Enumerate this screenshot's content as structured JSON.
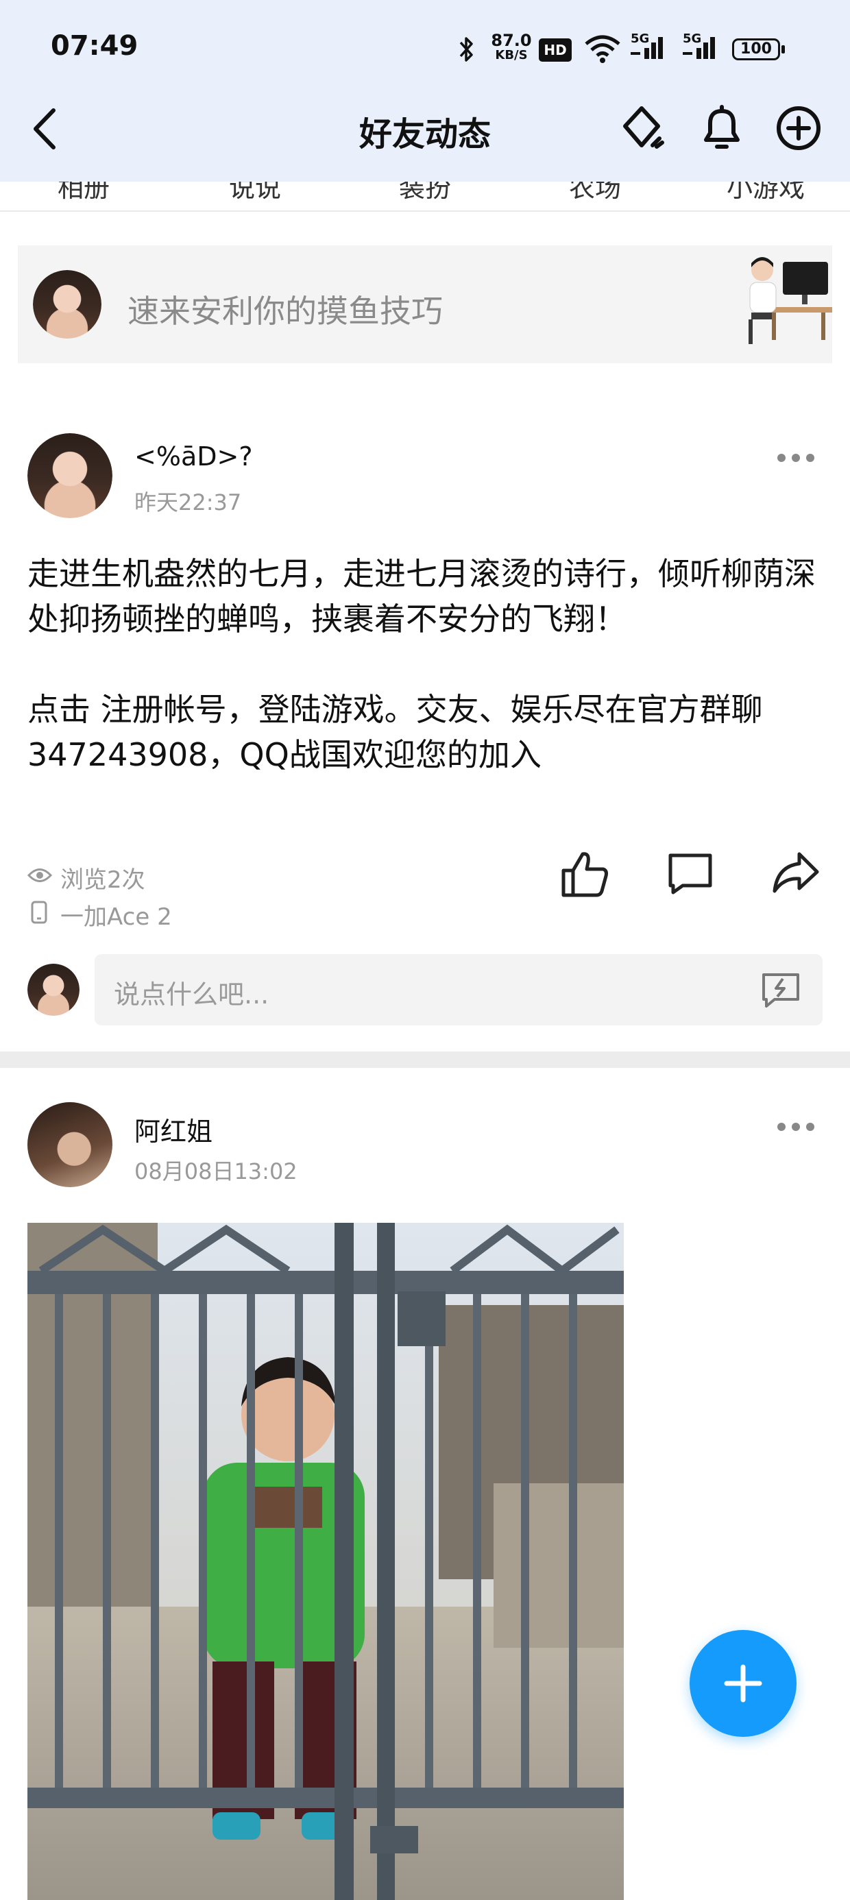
{
  "status_bar": {
    "time": "07:49",
    "net_speed_value": "87.0",
    "net_speed_unit": "KB/S",
    "hd_label": "HD",
    "signal1_label": "5G",
    "signal2_label": "5G",
    "battery": "100"
  },
  "header": {
    "title": "好友动态"
  },
  "tabs": [
    "相册",
    "说说",
    "装扮",
    "农场",
    "小游戏"
  ],
  "composer": {
    "placeholder": "速来安利你的摸鱼技巧"
  },
  "post1": {
    "username": "<%āD>?",
    "time": "昨天22:37",
    "text": "走进生机盎然的七月，走进七月滚烫的诗行，倾听柳荫深处抑扬顿挫的蝉鸣，挟裹着不安分的飞翔！\n\n点击 注册帐号，登陆游戏。交友、娱乐尽在官方群聊347243908，QQ战国欢迎您的加入",
    "views": "浏览2次",
    "device": "一加Ace 2",
    "comment_placeholder": "说点什么吧..."
  },
  "post2": {
    "username": "阿红姐",
    "time": "08月08日13:02"
  },
  "colors": {
    "accent": "#159bfb",
    "header_bg": "#eaf0fb"
  }
}
